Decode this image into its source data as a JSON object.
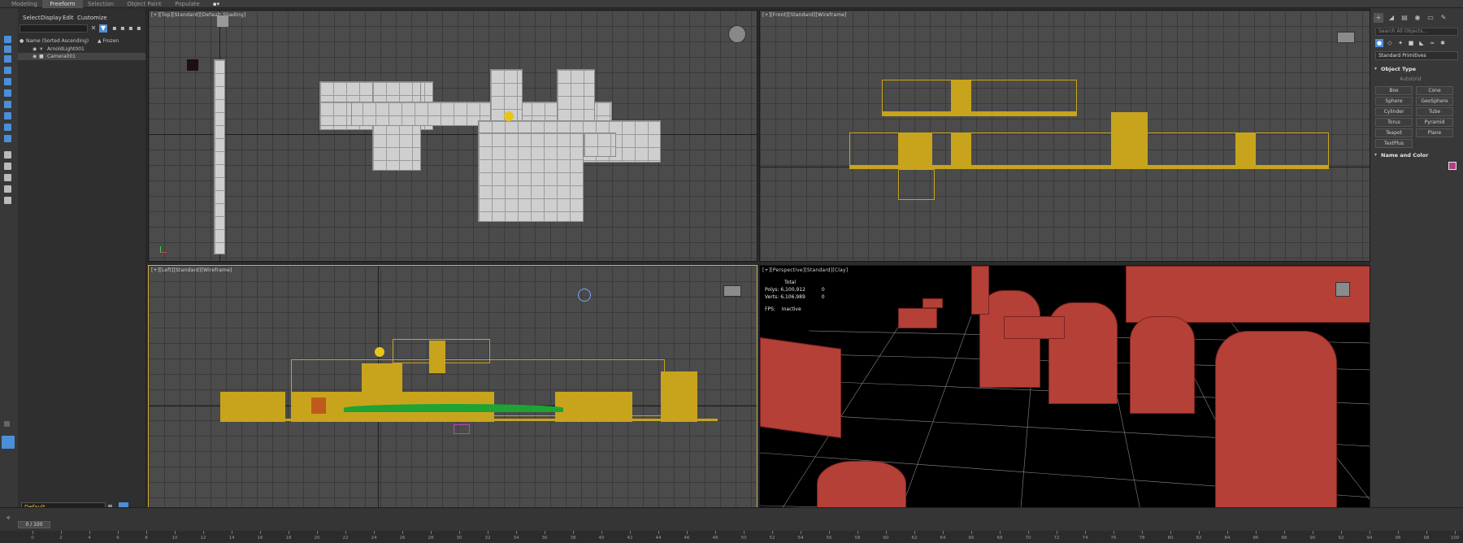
{
  "ribbon": {
    "tabs": [
      {
        "label": "Modeling",
        "active": false
      },
      {
        "label": "Freeform",
        "active": true
      },
      {
        "label": "Selection",
        "active": false
      },
      {
        "label": "Object Paint",
        "active": false
      },
      {
        "label": "Populate",
        "active": false
      }
    ]
  },
  "explorer": {
    "menu": [
      "Select",
      "Display",
      "Edit",
      "Customize"
    ],
    "column_name": "Name (Sorted Ascending)",
    "column_frozen": "▲ Frozen",
    "rows": [
      {
        "name": "ArnoldLight001",
        "selected": false
      },
      {
        "name": "Camera001",
        "selected": true
      }
    ],
    "layer": "Default"
  },
  "viewports": {
    "top": {
      "label": "[+][Top][Standard][Default Shading]"
    },
    "front": {
      "label": "[+][Front][Standard][Wireframe]"
    },
    "left": {
      "label": "[+][Left][Standard][Wireframe]"
    },
    "perspective": {
      "label": "[+][Perspective][Standard][Clay]",
      "stats": {
        "total_label": "Total",
        "polys_label": "Polys:",
        "polys_value": "6,100,912",
        "polys_sel": "0",
        "verts_label": "Verts:",
        "verts_value": "6,106,989",
        "verts_sel": "0",
        "fps_label": "FPS:",
        "fps_value": "Inactive"
      }
    }
  },
  "command_panel": {
    "search_placeholder": "Search All Objects...",
    "category": "Standard Primitives",
    "object_type_title": "Object Type",
    "autogrid": "AutoGrid",
    "primitives": [
      "Box",
      "Cone",
      "Sphere",
      "GeoSphere",
      "Cylinder",
      "Tube",
      "Torus",
      "Pyramid",
      "Teapot",
      "Plane",
      "TextPlus"
    ],
    "name_color_title": "Name and Color",
    "color": "#b83b8a"
  },
  "timeline": {
    "frame_display": "0 / 100",
    "ticks": [
      "0",
      "2",
      "4",
      "6",
      "8",
      "10",
      "12",
      "14",
      "16",
      "18",
      "20",
      "22",
      "24",
      "26",
      "28",
      "30",
      "32",
      "34",
      "36",
      "38",
      "40",
      "42",
      "44",
      "46",
      "48",
      "50",
      "52",
      "54",
      "56",
      "58",
      "60",
      "62",
      "64",
      "66",
      "68",
      "70",
      "72",
      "74",
      "76",
      "78",
      "80",
      "82",
      "84",
      "86",
      "88",
      "90",
      "92",
      "94",
      "96",
      "98",
      "100"
    ]
  },
  "colors": {
    "accent_blue": "#4b8fd8",
    "wireframe_yellow": "#c8a41c",
    "clay_red": "#b54038",
    "active_border": "#d6b23c"
  }
}
